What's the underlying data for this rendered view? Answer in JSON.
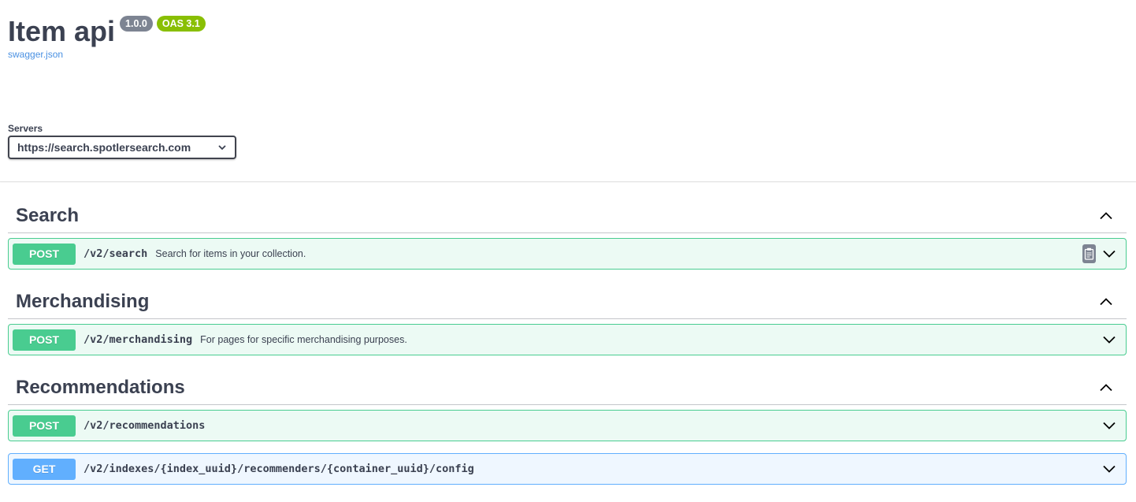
{
  "info": {
    "title": "Item api",
    "version": "1.0.0",
    "oas_version": "OAS 3.1",
    "spec_link": "swagger.json"
  },
  "servers": {
    "label": "Servers",
    "selected": "https://search.spotlersearch.com"
  },
  "tags": [
    {
      "name": "Search",
      "operations": [
        {
          "method": "POST",
          "path": "/v2/search",
          "summary": "Search for items in your collection."
        }
      ]
    },
    {
      "name": "Merchandising",
      "operations": [
        {
          "method": "POST",
          "path": "/v2/merchandising",
          "summary": "For pages for specific merchandising purposes."
        }
      ]
    },
    {
      "name": "Recommendations",
      "operations": [
        {
          "method": "POST",
          "path": "/v2/recommendations",
          "summary": ""
        },
        {
          "method": "GET",
          "path": "/v2/indexes/{index_uuid}/recommenders/{container_uuid}/config",
          "summary": ""
        }
      ]
    }
  ],
  "colors": {
    "post": "#49cc90",
    "get": "#61affe",
    "version_badge": "#7d8492",
    "oas_badge": "#89bf04",
    "link": "#4990e2"
  },
  "icons": {
    "tag_toggle": "chevron-up-icon",
    "op_toggle": "chevron-down-icon",
    "copy": "clipboard-icon",
    "select": "chevron-down-icon"
  }
}
